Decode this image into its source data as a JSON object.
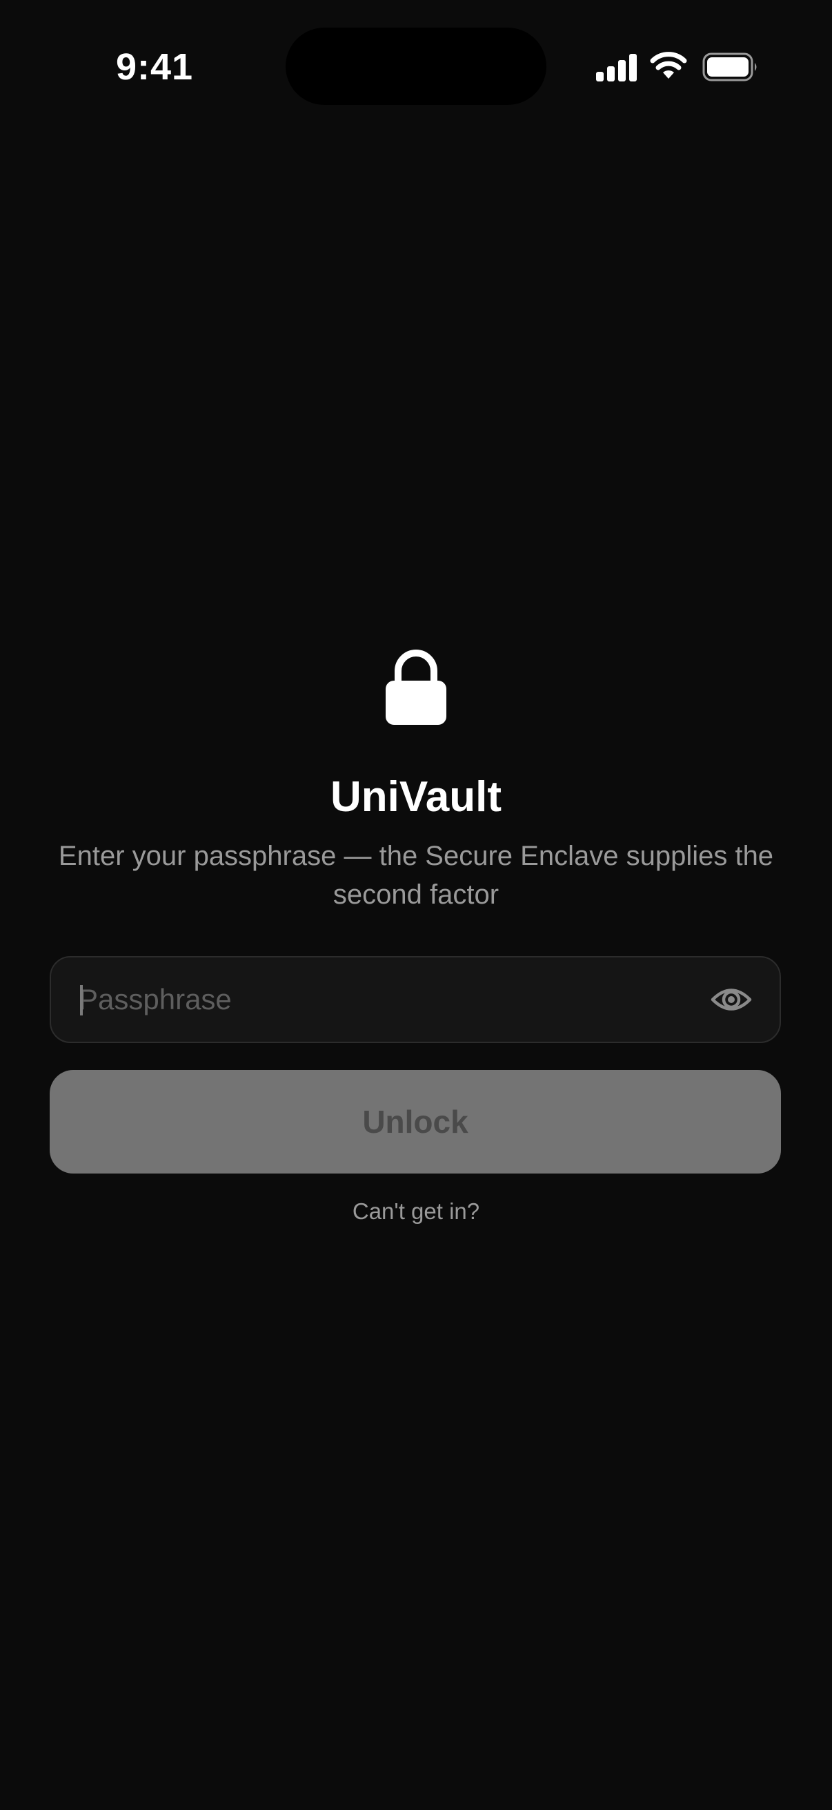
{
  "status_bar": {
    "time": "9:41",
    "signal_icon": "cellular-signal-icon",
    "wifi_icon": "wifi-icon",
    "battery_icon": "battery-icon"
  },
  "lock_screen": {
    "icon": "lock-icon",
    "title": "UniVault",
    "subtitle": "Enter your passphrase — the Secure Enclave supplies the second factor",
    "passphrase_field": {
      "value": "",
      "placeholder": "Passphrase",
      "reveal_icon": "eye-icon"
    },
    "unlock_label": "Unlock",
    "help_label": "Can't get in?"
  },
  "colors": {
    "background": "#0b0b0b",
    "field_background": "#151515",
    "button_disabled": "#747474",
    "muted_text": "#9a9a9a"
  }
}
